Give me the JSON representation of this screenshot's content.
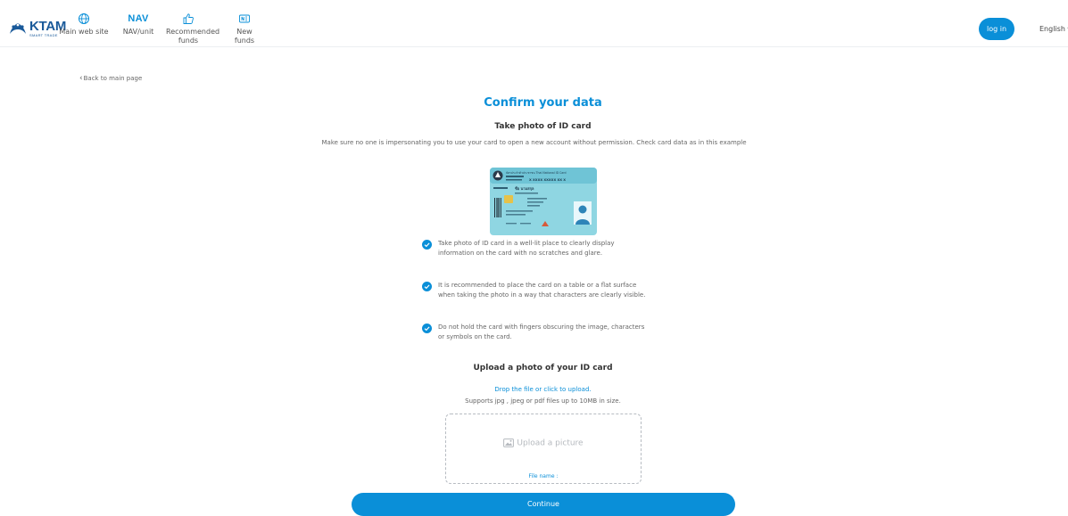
{
  "header": {
    "logo_text": "KTAM",
    "logo_subtext": "SMART TRADE",
    "nav": [
      {
        "label": "Main web site",
        "icon": "globe-icon"
      },
      {
        "label": "NAV/unit",
        "glyph": "NAV"
      },
      {
        "label": "Recommended funds",
        "icon": "thumbs-up-icon"
      },
      {
        "label": "New funds",
        "icon": "new-badge-icon"
      }
    ],
    "login_label": "log in",
    "language": "English"
  },
  "back_link": "Back to main page",
  "page": {
    "title": "Confirm your data",
    "subtitle": "Take photo of ID card",
    "description": "Make sure no one is impersonating you to use your card to open a new account without permission. Check card data as in this example",
    "id_card": {
      "header_text": "บัตรประจำตัวประชาชน Thai National ID Card",
      "id_number": "X XXXX XXXXX XX X",
      "name": "ชื่อ นามสกุล",
      "accent_color": "#7fd0de"
    },
    "tips": [
      "Take photo of ID card in a well-lit place to clearly display information on the card with no scratches and glare.",
      "It is recommended to place the card on a table or a flat surface when taking the photo in a way that characters are clearly visible.",
      "Do not hold the card with fingers obscuring the image, characters or symbols on the card."
    ]
  },
  "upload": {
    "title": "Upload a photo of your ID card",
    "drop_link": "Drop the file or click to upload.",
    "supports": "Supports jpg , jpeg or pdf files up to 10MB in size.",
    "placeholder": "Upload a picture",
    "file_name_label": "File name :"
  },
  "continue_label": "Continue",
  "colors": {
    "accent": "#0a8fd8",
    "brand": "#1a5a9a"
  }
}
